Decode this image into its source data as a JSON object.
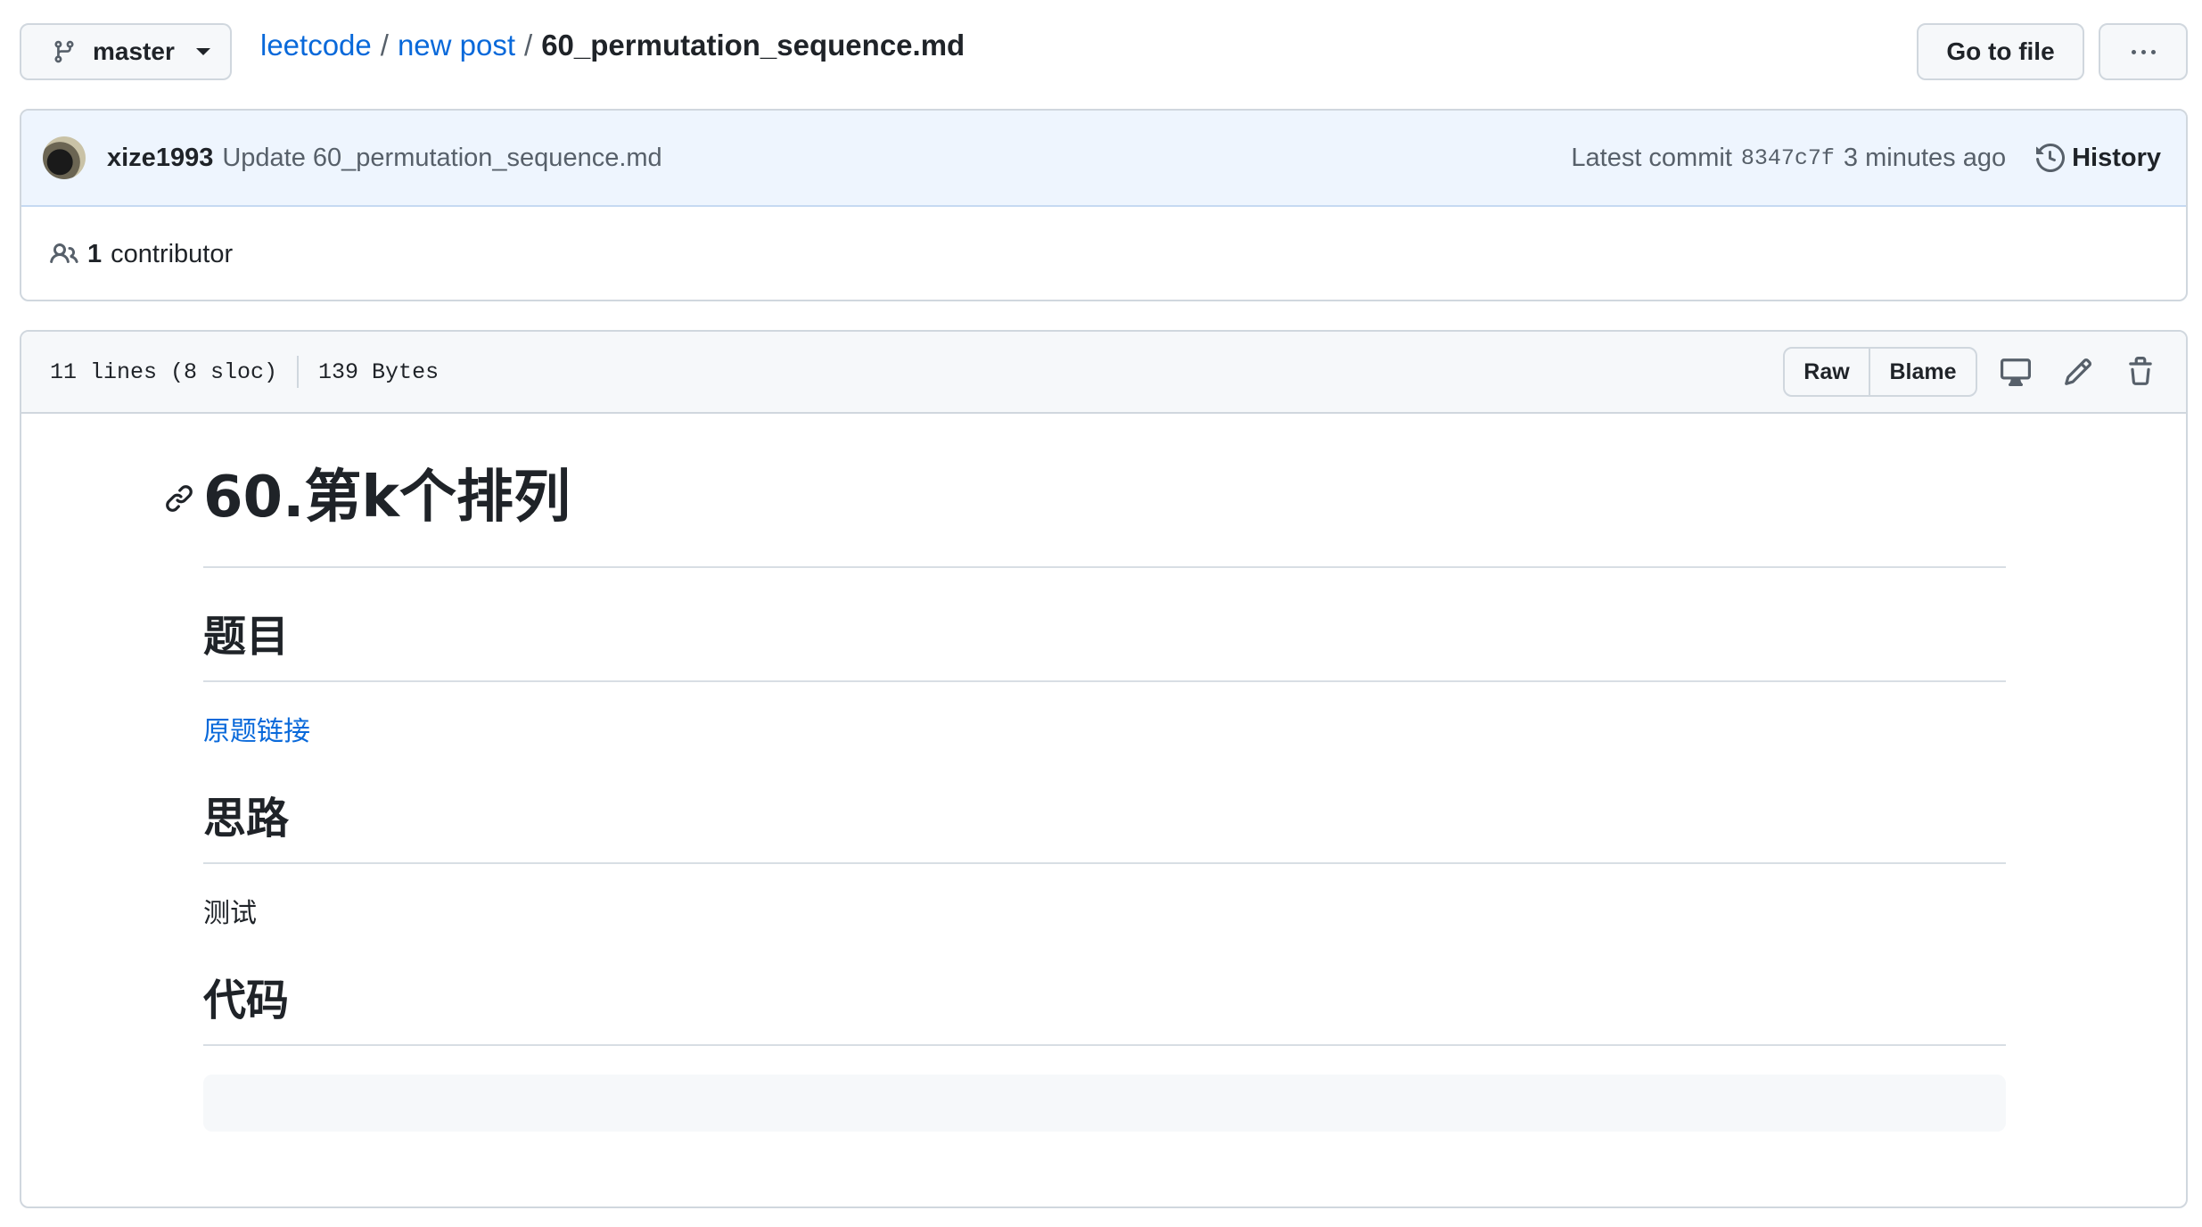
{
  "branch": {
    "label": "master"
  },
  "breadcrumb": {
    "repo": "leetcode",
    "folder": "new post",
    "file": "60_permutation_sequence.md",
    "separator": "/"
  },
  "actions": {
    "go_to_file": "Go to file"
  },
  "commit": {
    "author": "xize1993",
    "message": "Update 60_permutation_sequence.md",
    "latest_label": "Latest commit",
    "hash": "8347c7f",
    "time": "3 minutes ago",
    "history_label": "History"
  },
  "contributors": {
    "count": "1",
    "label": "contributor"
  },
  "file_info": {
    "lines": "11 lines (8 sloc)",
    "size": "139 Bytes",
    "raw_label": "Raw",
    "blame_label": "Blame"
  },
  "markdown": {
    "title": "60.第k个排列",
    "sections": [
      {
        "heading": "题目",
        "link_text": "原题链接"
      },
      {
        "heading": "思路",
        "text": "测试"
      },
      {
        "heading": "代码"
      }
    ]
  },
  "colors": {
    "accent": "#0969da",
    "text": "#1f2328",
    "muted": "#57606a",
    "border": "#d0d7de",
    "commit_bg": "#eef5fe"
  }
}
